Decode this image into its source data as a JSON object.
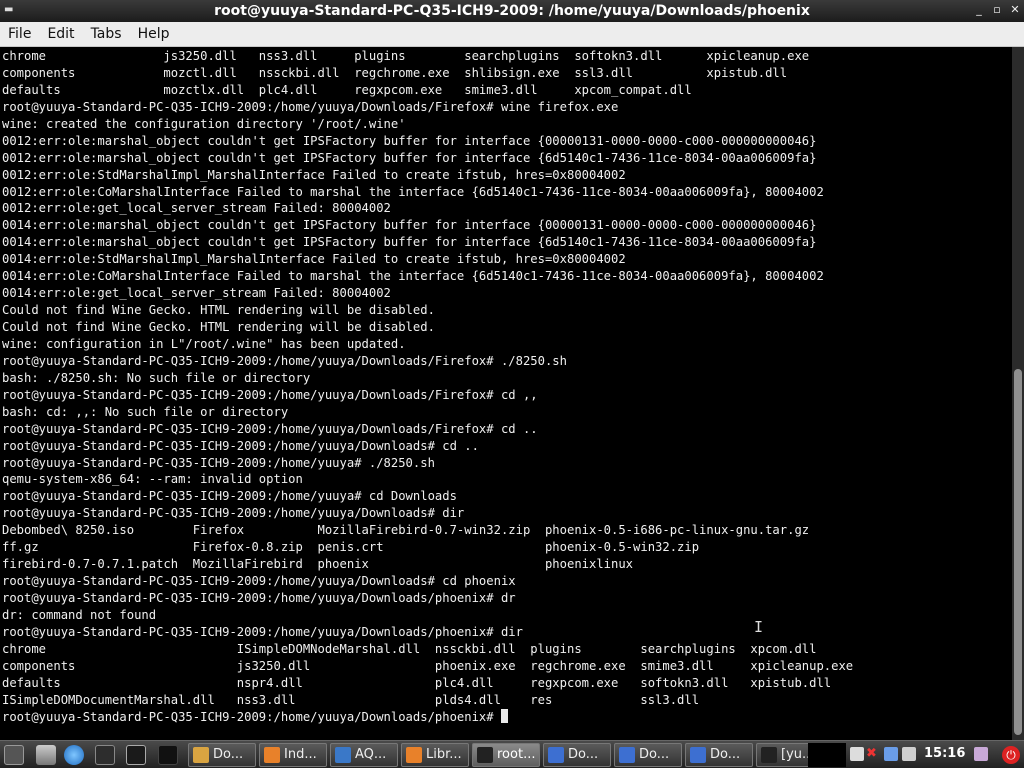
{
  "window": {
    "title": "root@yuuya-Standard-PC-Q35-ICH9-2009: /home/yuuya/Downloads/phoenix",
    "controls": {
      "minimize": "_",
      "maximize": "▫",
      "close": "✕"
    }
  },
  "menubar": {
    "items": [
      "File",
      "Edit",
      "Tabs",
      "Help"
    ]
  },
  "terminal": {
    "lines": [
      "chrome                js3250.dll   nss3.dll     plugins        searchplugins  softokn3.dll      xpicleanup.exe",
      "components            mozctl.dll   nssckbi.dll  regchrome.exe  shlibsign.exe  ssl3.dll          xpistub.dll",
      "defaults              mozctlx.dll  plc4.dll     regxpcom.exe   smime3.dll     xpcom_compat.dll",
      "root@yuuya-Standard-PC-Q35-ICH9-2009:/home/yuuya/Downloads/Firefox# wine firefox.exe",
      "wine: created the configuration directory '/root/.wine'",
      "0012:err:ole:marshal_object couldn't get IPSFactory buffer for interface {00000131-0000-0000-c000-000000000046}",
      "0012:err:ole:marshal_object couldn't get IPSFactory buffer for interface {6d5140c1-7436-11ce-8034-00aa006009fa}",
      "0012:err:ole:StdMarshalImpl_MarshalInterface Failed to create ifstub, hres=0x80004002",
      "0012:err:ole:CoMarshalInterface Failed to marshal the interface {6d5140c1-7436-11ce-8034-00aa006009fa}, 80004002",
      "0012:err:ole:get_local_server_stream Failed: 80004002",
      "0014:err:ole:marshal_object couldn't get IPSFactory buffer for interface {00000131-0000-0000-c000-000000000046}",
      "0014:err:ole:marshal_object couldn't get IPSFactory buffer for interface {6d5140c1-7436-11ce-8034-00aa006009fa}",
      "0014:err:ole:StdMarshalImpl_MarshalInterface Failed to create ifstub, hres=0x80004002",
      "0014:err:ole:CoMarshalInterface Failed to marshal the interface {6d5140c1-7436-11ce-8034-00aa006009fa}, 80004002",
      "0014:err:ole:get_local_server_stream Failed: 80004002",
      "Could not find Wine Gecko. HTML rendering will be disabled.",
      "Could not find Wine Gecko. HTML rendering will be disabled.",
      "wine: configuration in L\"/root/.wine\" has been updated.",
      "root@yuuya-Standard-PC-Q35-ICH9-2009:/home/yuuya/Downloads/Firefox# ./8250.sh",
      "bash: ./8250.sh: No such file or directory",
      "root@yuuya-Standard-PC-Q35-ICH9-2009:/home/yuuya/Downloads/Firefox# cd ,,",
      "bash: cd: ,,: No such file or directory",
      "root@yuuya-Standard-PC-Q35-ICH9-2009:/home/yuuya/Downloads/Firefox# cd ..",
      "root@yuuya-Standard-PC-Q35-ICH9-2009:/home/yuuya/Downloads# cd ..",
      "root@yuuya-Standard-PC-Q35-ICH9-2009:/home/yuuya# ./8250.sh",
      "qemu-system-x86_64: --ram: invalid option",
      "root@yuuya-Standard-PC-Q35-ICH9-2009:/home/yuuya# cd Downloads",
      "root@yuuya-Standard-PC-Q35-ICH9-2009:/home/yuuya/Downloads# dir",
      "Debombed\\ 8250.iso        Firefox          MozillaFirebird-0.7-win32.zip  phoenix-0.5-i686-pc-linux-gnu.tar.gz",
      "ff.gz                     Firefox-0.8.zip  penis.crt                      phoenix-0.5-win32.zip",
      "firebird-0.7-0.7.1.patch  MozillaFirebird  phoenix                        phoenixlinux",
      "root@yuuya-Standard-PC-Q35-ICH9-2009:/home/yuuya/Downloads# cd phoenix",
      "root@yuuya-Standard-PC-Q35-ICH9-2009:/home/yuuya/Downloads/phoenix# dr",
      "dr: command not found",
      "root@yuuya-Standard-PC-Q35-ICH9-2009:/home/yuuya/Downloads/phoenix# dir",
      "chrome                          ISimpleDOMNodeMarshal.dll  nssckbi.dll  plugins        searchplugins  xpcom.dll",
      "components                      js3250.dll                 phoenix.exe  regchrome.exe  smime3.dll     xpicleanup.exe",
      "defaults                        nspr4.dll                  plc4.dll     regxpcom.exe   softokn3.dll   xpistub.dll",
      "ISimpleDOMDocumentMarshal.dll   nss3.dll                   plds4.dll    res            ssl3.dll"
    ],
    "prompt": "root@yuuya-Standard-PC-Q35-ICH9-2009:/home/yuuya/Downloads/phoenix# "
  },
  "taskbar": {
    "tasks": [
      {
        "label": "Do...",
        "icon": "folder-icon",
        "color": "#d9a441"
      },
      {
        "label": "Ind...",
        "icon": "firefox-icon",
        "color": "#e8812a"
      },
      {
        "label": "AQ...",
        "icon": "browser-icon",
        "color": "#3a78c8"
      },
      {
        "label": "Libr...",
        "icon": "firefox-icon",
        "color": "#e8812a"
      },
      {
        "label": "root...",
        "icon": "terminal-icon",
        "color": "#222222",
        "active": true
      },
      {
        "label": "Do...",
        "icon": "document-icon",
        "color": "#3d6fd1"
      },
      {
        "label": "Do...",
        "icon": "document-icon",
        "color": "#3d6fd1"
      },
      {
        "label": "Do...",
        "icon": "document-icon",
        "color": "#3d6fd1"
      },
      {
        "label": "[yu...",
        "icon": "terminal-icon",
        "color": "#222222"
      }
    ],
    "clock": "15:16"
  }
}
